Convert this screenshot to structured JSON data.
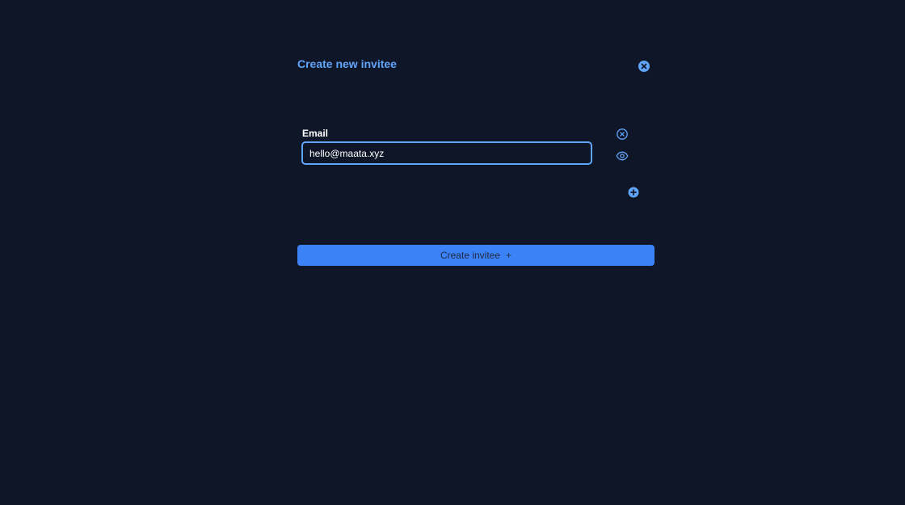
{
  "dialog": {
    "title": "Create new invitee",
    "close_icon": "close-circle-filled-icon"
  },
  "form": {
    "email_label": "Email",
    "email_value": "hello@maata.xyz",
    "clear_icon": "close-circle-outline-icon",
    "visibility_icon": "eye-icon",
    "add_icon": "plus-circle-filled-icon"
  },
  "actions": {
    "create_label": "Create invitee",
    "create_icon": "+"
  },
  "colors": {
    "background": "#0f1627",
    "accent": "#60a5fa",
    "button": "#3b82f6"
  }
}
